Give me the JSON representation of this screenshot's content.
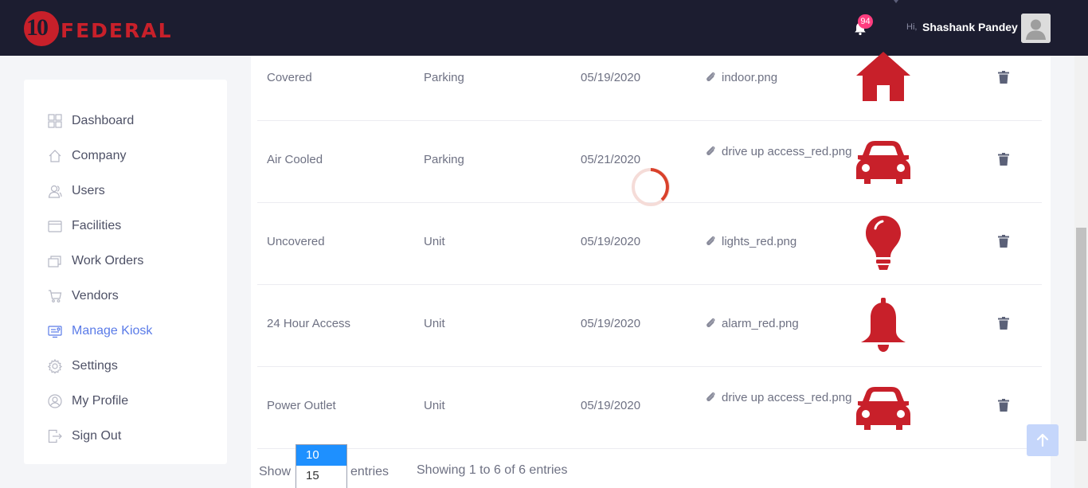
{
  "brand": {
    "logo_number": "10",
    "logo_word": "FEDERAL"
  },
  "header": {
    "notification_count": "94",
    "greeting": "Hi,",
    "user_name": "Shashank Pandey"
  },
  "sidebar": {
    "items": [
      {
        "label": "Dashboard",
        "icon": "dashboard-icon",
        "active": false
      },
      {
        "label": "Company",
        "icon": "home-icon",
        "active": false
      },
      {
        "label": "Users",
        "icon": "users-icon",
        "active": false
      },
      {
        "label": "Facilities",
        "icon": "facilities-icon",
        "active": false
      },
      {
        "label": "Work Orders",
        "icon": "work-orders-icon",
        "active": false
      },
      {
        "label": "Vendors",
        "icon": "cart-icon",
        "active": false
      },
      {
        "label": "Manage Kiosk",
        "icon": "kiosk-icon",
        "active": true
      },
      {
        "label": "Settings",
        "icon": "gear-icon",
        "active": false
      },
      {
        "label": "My Profile",
        "icon": "profile-icon",
        "active": false
      },
      {
        "label": "Sign Out",
        "icon": "sign-out-icon",
        "active": false
      }
    ]
  },
  "table": {
    "rows": [
      {
        "name": "Covered",
        "type": "Parking",
        "date": "05/19/2020",
        "file": "indoor.png",
        "icon": "house-icon"
      },
      {
        "name": "Air Cooled",
        "type": "Parking",
        "date": "05/21/2020",
        "file": "drive up access_red.png",
        "icon": "car-icon"
      },
      {
        "name": "Uncovered",
        "type": "Unit",
        "date": "05/19/2020",
        "file": "lights_red.png",
        "icon": "lightbulb-icon"
      },
      {
        "name": "24 Hour Access",
        "type": "Unit",
        "date": "05/19/2020",
        "file": "alarm_red.png",
        "icon": "bell-alarm-icon"
      },
      {
        "name": "Power Outlet",
        "type": "Unit",
        "date": "05/19/2020",
        "file": "drive up access_red.png",
        "icon": "car-icon"
      }
    ]
  },
  "pagination": {
    "show_label": "Show",
    "entries_label": "entries",
    "options": [
      "10",
      "15"
    ],
    "selected": "10",
    "info": "Showing 1 to 6 of 6 entries"
  },
  "colors": {
    "header_bg": "#1c1d30",
    "brand_red": "#c8202a",
    "active_nav": "#5a7be8",
    "badge": "#ff3d7f"
  }
}
